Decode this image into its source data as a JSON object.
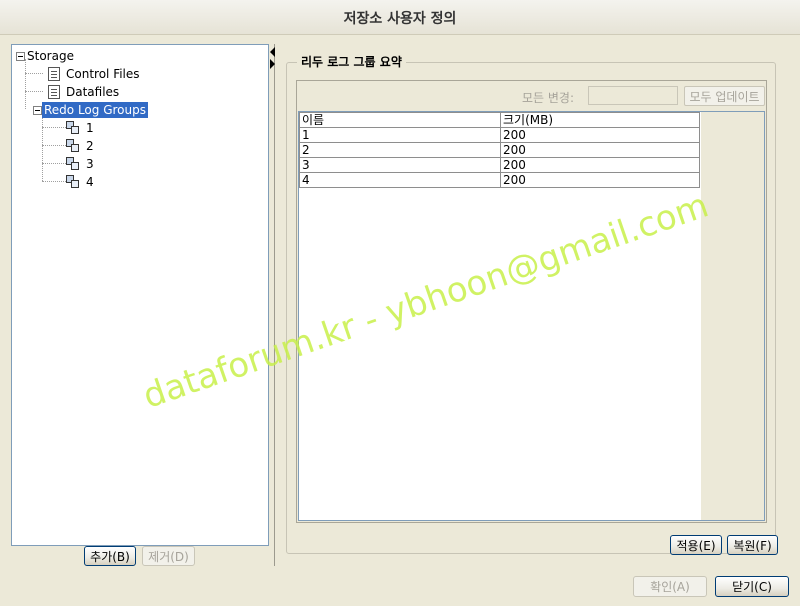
{
  "window": {
    "title": "저장소 사용자 정의"
  },
  "tree": {
    "root": "Storage",
    "children": [
      {
        "label": "Control Files"
      },
      {
        "label": "Datafiles"
      },
      {
        "label": "Redo Log Groups",
        "selected": true,
        "children": [
          {
            "label": "1"
          },
          {
            "label": "2"
          },
          {
            "label": "3"
          },
          {
            "label": "4"
          }
        ]
      }
    ]
  },
  "left_buttons": {
    "add": "추가(B)",
    "remove": "제거(D)"
  },
  "summary": {
    "title": "리두 로그 그룹 요약",
    "all_change_label": "모든 변경:",
    "all_change_value": "",
    "update_all": "모두 업데이트",
    "columns": [
      "이름",
      "크기(MB)"
    ],
    "rows": [
      [
        "1",
        "200"
      ],
      [
        "2",
        "200"
      ],
      [
        "3",
        "200"
      ],
      [
        "4",
        "200"
      ]
    ],
    "apply": "적용(E)",
    "revert": "복원(F)"
  },
  "footer": {
    "ok": "확인(A)",
    "close": "닫기(C)"
  },
  "watermark": "dataforum.kr - ybhoon@gmail.com"
}
